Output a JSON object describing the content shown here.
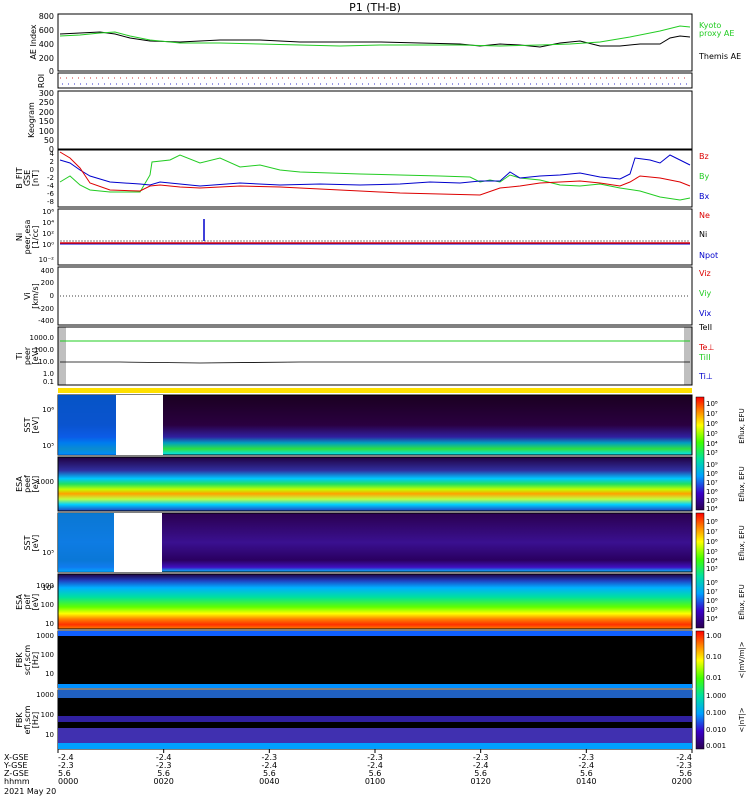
{
  "title": "P1 (TH-B)",
  "date_label": "2021 May 20",
  "colors": {
    "green": "#22cc22",
    "red": "#dd0000",
    "blue": "#0000cc",
    "black": "#000000"
  },
  "panels": {
    "ae": {
      "ylabel": "AE Index",
      "ticks": [
        "800",
        "600",
        "400",
        "200",
        "0"
      ],
      "legend_kyoto_1": "Kyoto",
      "legend_kyoto_2": "proxy AE",
      "legend_themis": "Themis AE"
    },
    "roi": {
      "ylabel": "ROI"
    },
    "keogram": {
      "ylabel": "Keogram",
      "ticks": [
        "300",
        "250",
        "200",
        "150",
        "100",
        "50",
        "0"
      ]
    },
    "bfield": {
      "ylabel_1": "B_FIT",
      "ylabel_2": "GSE",
      "ylabel_3": "[nT]",
      "ticks": [
        "4",
        "2",
        "0",
        "-2",
        "-4",
        "-6",
        "-8"
      ],
      "legend": [
        "Bz",
        "By",
        "Bx"
      ]
    },
    "density": {
      "ylabel_1": "Ni",
      "ylabel_2": "peer,esa",
      "ylabel_3": "[1/cc]",
      "ticks": [
        "10⁶",
        "10⁴",
        "10²",
        "10⁰",
        "10⁻²"
      ],
      "legend": [
        "Ne",
        "Ni",
        "Npot"
      ]
    },
    "velocity": {
      "ylabel_1": "Vi",
      "ylabel_2": "[km/s]",
      "ticks": [
        "400",
        "200",
        "0",
        "-200",
        "-400"
      ],
      "legend": [
        "Viz",
        "Viy",
        "Vix"
      ]
    },
    "temperature": {
      "ylabel_1": "Ti",
      "ylabel_2": "peer",
      "ylabel_3": "[eV]",
      "ticks": [
        "1000.0",
        "100.0",
        "10.0",
        "1.0",
        "0.1"
      ],
      "legend": [
        "TeII",
        "Te⊥",
        "TiII",
        "Ti⊥"
      ]
    },
    "sst_e": {
      "ylabel_1": "SST",
      "ylabel_2": "[eV]",
      "ticks": [
        "10⁶",
        "10⁵"
      ],
      "cb_ticks": [
        "10⁸",
        "10⁷",
        "10⁶",
        "10⁵",
        "10⁴",
        "10³"
      ],
      "cb_label": "Eflux, EFU"
    },
    "esa_e": {
      "ylabel_1": "ESA",
      "ylabel_2": "peef",
      "ylabel_3": "[eV]",
      "ticks": [
        "1000"
      ],
      "cb_ticks": [
        "10⁹",
        "10⁸",
        "10⁷",
        "10⁶",
        "10⁵",
        "10⁴"
      ],
      "cb_label": "Eflux, EFU"
    },
    "sst_i": {
      "ylabel_1": "SST",
      "ylabel_2": "[eV]",
      "ticks": [
        "10⁵",
        "10⁶"
      ],
      "cb_ticks": [
        "10⁸",
        "10⁷",
        "10⁶",
        "10⁵",
        "10⁴",
        "10³"
      ],
      "cb_label": "Eflux, EFU"
    },
    "esa_i": {
      "ylabel_1": "ESA",
      "ylabel_2": "peif",
      "ylabel_3": "[eV]",
      "ticks": [
        "1000",
        "100",
        "10"
      ],
      "cb_ticks": [
        "10⁸",
        "10⁷",
        "10⁶",
        "10⁵",
        "10⁴"
      ],
      "cb_label": "Eflux, EFU"
    },
    "fbk_scm": {
      "ylabel_1": "FBK",
      "ylabel_2": "scf,scm",
      "ylabel_3": "[Hz]",
      "ticks": [
        "1000",
        "100",
        "10"
      ],
      "cb_ticks": [
        "1.00",
        "0.10",
        "0.01"
      ],
      "cb_label": "<|mV/m|>"
    },
    "fbk_efi": {
      "ylabel_1": "FBK",
      "ylabel_2": "efi,scm",
      "ylabel_3": "[Hz]",
      "ticks": [
        "1000",
        "100",
        "10"
      ],
      "cb_ticks": [
        "1.000",
        "0.100",
        "0.010",
        "0.001"
      ],
      "cb_label": "<|nT|>"
    }
  },
  "time_axis": {
    "row_labels": [
      "X-GSE",
      "Y-GSE",
      "Z-GSE",
      "hhmm"
    ],
    "columns": [
      {
        "x": "-2.4",
        "y": "-2.3",
        "z": "5.6",
        "t": "0000"
      },
      {
        "x": "-2.4",
        "y": "-2.3",
        "z": "5.6",
        "t": "0020"
      },
      {
        "x": "-2.3",
        "y": "-2.4",
        "z": "5.6",
        "t": "0040"
      },
      {
        "x": "-2.3",
        "y": "-2.4",
        "z": "5.6",
        "t": "0100"
      },
      {
        "x": "-2.3",
        "y": "-2.4",
        "z": "5.6",
        "t": "0120"
      },
      {
        "x": "-2.3",
        "y": "-2.4",
        "z": "5.6",
        "t": "0140"
      },
      {
        "x": "-2.4",
        "y": "-2.3",
        "z": "5.6",
        "t": "0200"
      }
    ]
  },
  "chart_data": [
    {
      "type": "line",
      "panel": "AE Index",
      "x": [
        "0000",
        "0020",
        "0040",
        "0100",
        "0120",
        "0140",
        "0200"
      ],
      "series": [
        {
          "name": "Kyoto proxy AE",
          "values": [
            530,
            400,
            360,
            360,
            350,
            420,
            620
          ]
        },
        {
          "name": "Themis AE",
          "values": [
            520,
            410,
            420,
            400,
            320,
            360,
            520
          ]
        }
      ],
      "ylim": [
        0,
        800
      ]
    },
    {
      "type": "line",
      "panel": "B_FIT GSE",
      "x": [
        "0000",
        "0020",
        "0040",
        "0100",
        "0120",
        "0140",
        "0200"
      ],
      "series": [
        {
          "name": "Bz",
          "values": [
            3,
            -3,
            -3,
            -3,
            -4,
            -3,
            -3
          ]
        },
        {
          "name": "By",
          "values": [
            -4,
            2,
            0,
            -1,
            -3,
            -1,
            -6
          ]
        },
        {
          "name": "Bx",
          "values": [
            0,
            -3,
            -3,
            -3,
            -2,
            -2,
            2
          ]
        }
      ],
      "ylim": [
        -8,
        4
      ]
    },
    {
      "type": "line",
      "panel": "Ti peer",
      "x": [
        "0000",
        "0020",
        "0040",
        "0100",
        "0120",
        "0140",
        "0200"
      ],
      "series": [
        {
          "name": "TeII",
          "values": [
            1000,
            1000,
            1000,
            1000,
            1000,
            1000,
            1000
          ]
        },
        {
          "name": "TiII",
          "values": [
            10,
            10,
            10,
            10,
            10,
            10,
            10
          ]
        }
      ],
      "ylim": [
        0.1,
        1000
      ]
    },
    {
      "type": "heatmap",
      "panel": "spectrograms",
      "x": [
        "0000",
        "0020",
        "0040",
        "0100",
        "0120",
        "0140",
        "0200"
      ]
    }
  ]
}
